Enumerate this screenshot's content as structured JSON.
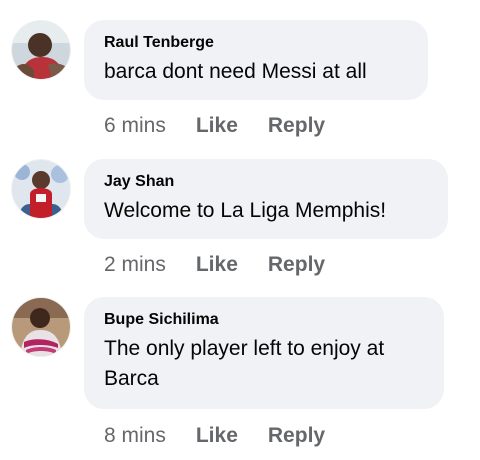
{
  "comments": [
    {
      "author": "Raul Tenberge",
      "text": "barca dont need Messi at all",
      "time": "6 mins",
      "like_label": "Like",
      "reply_label": "Reply"
    },
    {
      "author": "Jay Shan",
      "text": "Welcome to La Liga Memphis!",
      "time": "2 mins",
      "like_label": "Like",
      "reply_label": "Reply"
    },
    {
      "author": "Bupe Sichilima",
      "text": "The only player left to enjoy at Barca",
      "time": "8 mins",
      "like_label": "Like",
      "reply_label": "Reply"
    }
  ],
  "colors": {
    "bubble": "#f0f2f5",
    "meta_text": "#65676b",
    "text": "#050505"
  }
}
